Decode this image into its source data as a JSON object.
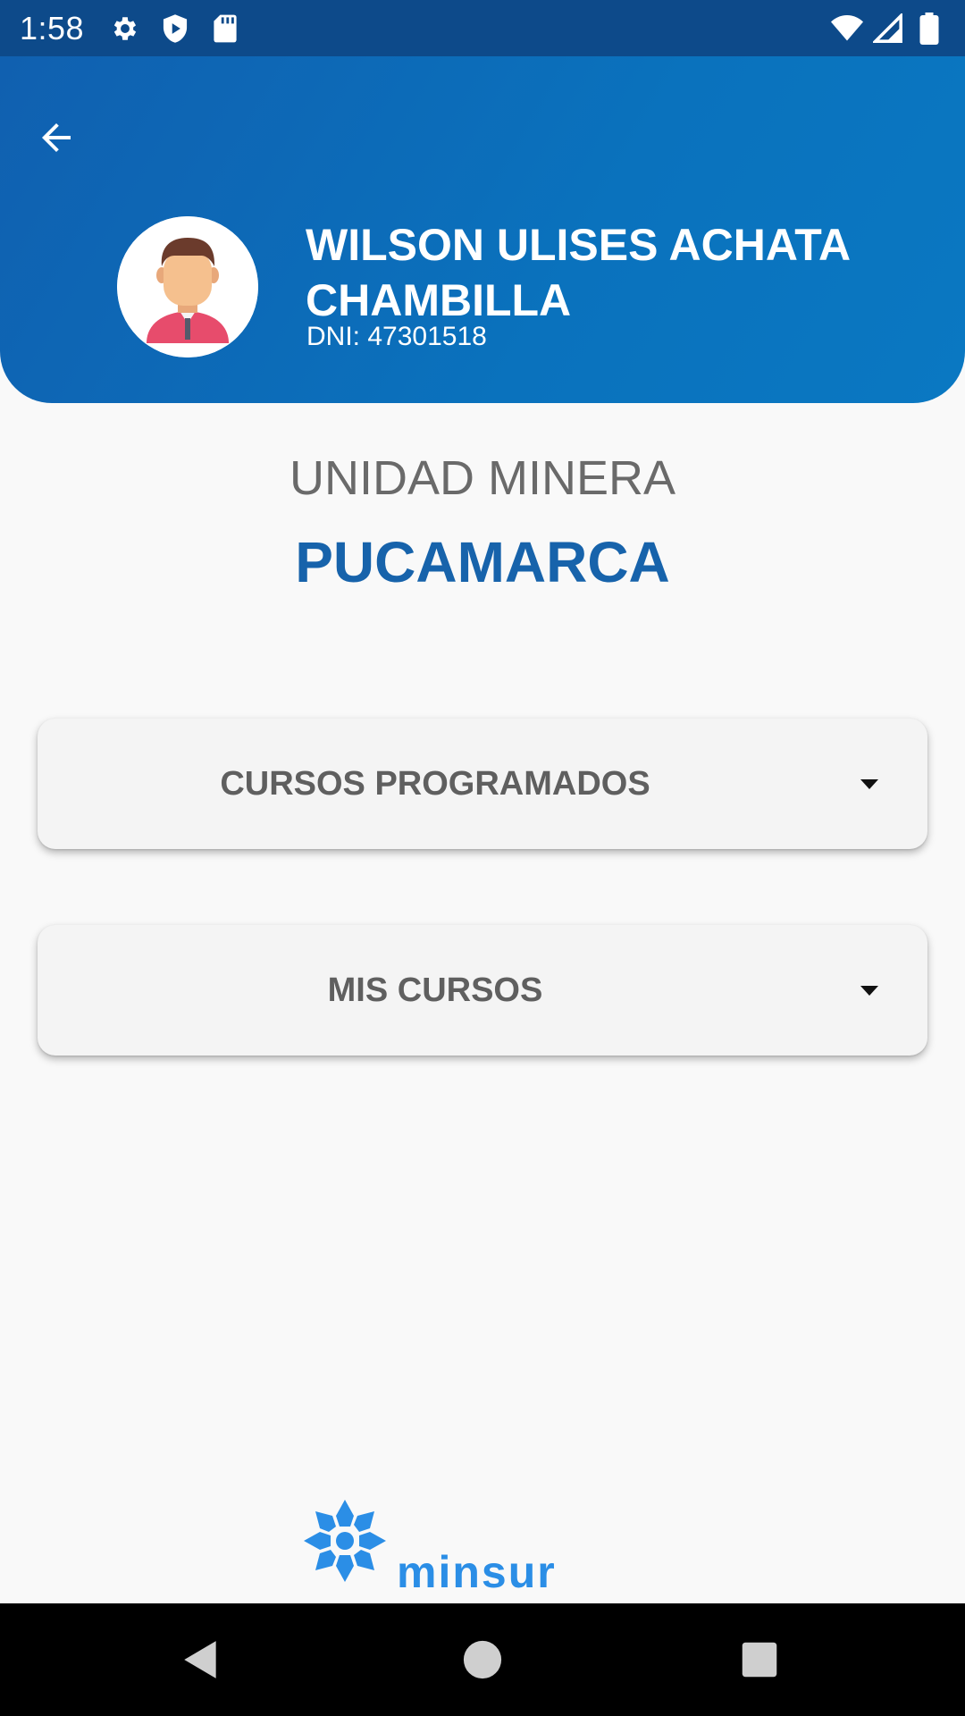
{
  "status_bar": {
    "time": "1:58",
    "icons": [
      "gear-icon",
      "shield-play-icon",
      "sd-card-icon",
      "wifi-icon",
      "signal-icon",
      "battery-icon"
    ]
  },
  "header": {
    "back_icon": "arrow-left-icon",
    "user": {
      "name": "WILSON ULISES ACHATA CHAMBILLA",
      "dni": "DNI: 47301518"
    }
  },
  "unit": {
    "label": "UNIDAD MINERA",
    "name": "PUCAMARCA"
  },
  "sections": [
    {
      "label": "CURSOS PROGRAMADOS",
      "icon": "caret-down-icon"
    },
    {
      "label": "MIS CURSOS",
      "icon": "caret-down-icon"
    }
  ],
  "logo": {
    "text": "minsur"
  },
  "nav_bar": {
    "icons": [
      "back-triangle-icon",
      "home-circle-icon",
      "recents-square-icon"
    ]
  },
  "colors": {
    "header_blue": "#0a6eba",
    "status_bar": "#0d4a8a",
    "title_blue": "#1763ab",
    "logo_blue": "#2b8ee6"
  }
}
